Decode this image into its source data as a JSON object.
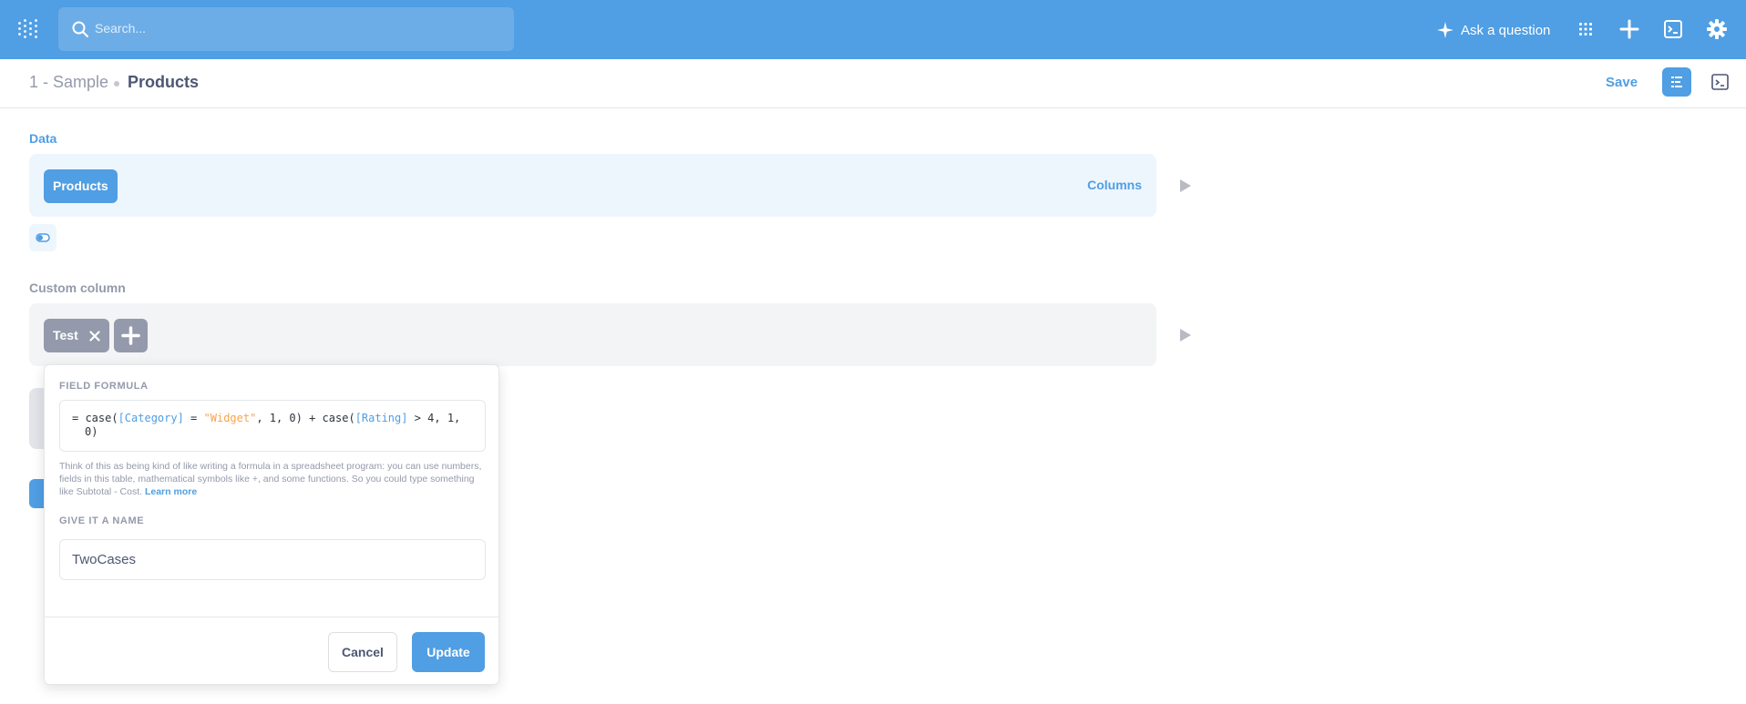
{
  "colors": {
    "brand": "#509ee3",
    "text_dark": "#4c5773",
    "text_light": "#949aab",
    "formula_string": "#f9a34c",
    "data_step_bg": "#eef6fd",
    "custom_step_bg": "#f3f4f6"
  },
  "topbar": {
    "logo_icon": "metabase-logo-icon",
    "search": {
      "placeholder": "Search...",
      "icon": "search-icon"
    },
    "ask_question_label": "Ask a question",
    "icons": [
      "apps-grid-icon",
      "plus-icon",
      "sql-editor-icon",
      "gear-icon"
    ]
  },
  "header": {
    "database": "1 - Sample",
    "table": "Products",
    "save_label": "Save",
    "notebook_icon": "notebook-icon",
    "sql_icon": "sql-preview-icon"
  },
  "notebook": {
    "data_step": {
      "label": "Data",
      "table_pill": "Products",
      "columns_label": "Columns"
    },
    "custom_column_step": {
      "label": "Custom column",
      "columns": [
        {
          "name": "Test"
        }
      ]
    }
  },
  "popover": {
    "formula_heading": "FIELD FORMULA",
    "formula": {
      "prefix": "= ",
      "t1": "case(",
      "f1": "[Category]",
      "t2": " = ",
      "s1": "\"Widget\"",
      "t3": ", 1, 0) + case(",
      "f2": "[Rating]",
      "t4": " > 4, 1,",
      "line2": "0)"
    },
    "help_text": "Think of this as being kind of like writing a formula in a spreadsheet program: you can use numbers, fields in this table, mathematical symbols like +, and some functions. So you could type something like Subtotal - Cost.",
    "learn_more": "Learn more",
    "name_heading": "GIVE IT A NAME",
    "name_value": "TwoCases",
    "cancel_label": "Cancel",
    "update_label": "Update"
  }
}
